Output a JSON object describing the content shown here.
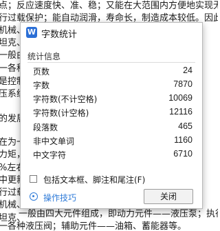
{
  "background_lines": [
    "点；反应速度快、准、稳；又能在大范围内方便地实现无级",
    "行过载保护；能自动润滑，寿命长，制造成本较低。因此，世界",
    "机械、",
    "坦克、",
    "一般由",
    "一各种",
    "是控制",
    "压系统",
    "",
    "的发展",
    "",
    "在为一",
    "力矩，",
    "%左右",
    "中更新",
    "行过载",
    "机械、",
    "坦克、",
    "一般由四大元件组成，即动力元件——液压泵；执行元件——",
    "一各种液压阀；辅助元件——油箱、蓄能器等。"
  ],
  "dialog": {
    "app_icon_text": "W",
    "title": "字数统计",
    "section_title": "统计信息",
    "stats": [
      {
        "label": "页数",
        "value": "24"
      },
      {
        "label": "字数",
        "value": "7870"
      },
      {
        "label": "字符数(不计空格)",
        "value": "10069"
      },
      {
        "label": "字符数(计空格)",
        "value": "12116"
      },
      {
        "label": "段落数",
        "value": "465"
      },
      {
        "label": "非中文单词",
        "value": "1160"
      },
      {
        "label": "中文字符",
        "value": "6710"
      }
    ],
    "checkbox_label": "包括文本框、脚注和尾注(F)",
    "checkbox_checked": false,
    "tips_label": "操作技巧",
    "close_label": "关闭"
  },
  "colors": {
    "accent": "#2f7bd8",
    "app_icon": "#2b6fd6"
  }
}
